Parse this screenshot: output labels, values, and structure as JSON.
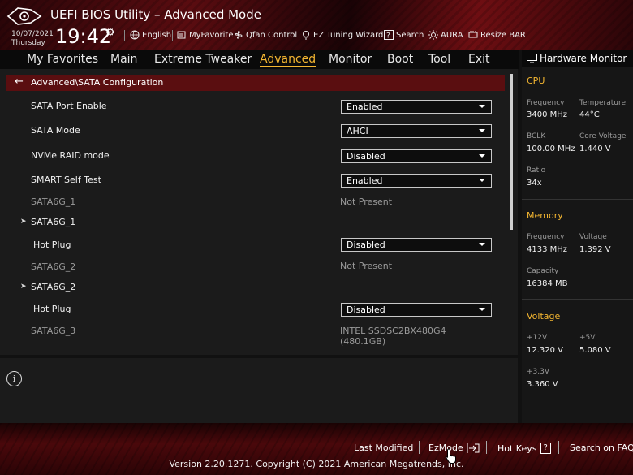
{
  "header": {
    "title": "UEFI BIOS Utility – Advanced Mode",
    "date": "10/07/2021",
    "day": "Thursday",
    "time": "19:42",
    "tools": [
      {
        "label": "English",
        "icon": "globe-icon"
      },
      {
        "label": "MyFavorite",
        "icon": "favorite-icon"
      },
      {
        "label": "Qfan Control",
        "icon": "fan-icon"
      },
      {
        "label": "EZ Tuning Wizard",
        "icon": "bulb-icon"
      },
      {
        "label": "Search",
        "icon": "search-icon"
      },
      {
        "label": "AURA",
        "icon": "aura-icon"
      },
      {
        "label": "Resize BAR",
        "icon": "resize-bar-icon"
      }
    ]
  },
  "menu": {
    "tabs": [
      "My Favorites",
      "Main",
      "Extreme Tweaker",
      "Advanced",
      "Monitor",
      "Boot",
      "Tool",
      "Exit"
    ],
    "active": "Advanced"
  },
  "breadcrumb": "Advanced\\SATA Configuration",
  "settings": [
    {
      "label": "SATA Port Enable",
      "value": "Enabled"
    },
    {
      "label": "SATA Mode",
      "value": "AHCI"
    },
    {
      "label": "NVMe RAID mode",
      "value": "Disabled"
    },
    {
      "label": "SMART Self Test",
      "value": "Enabled"
    },
    {
      "label": "SATA6G_1",
      "value": "Not Present"
    },
    {
      "label": "SATA6G_1"
    },
    {
      "label": "Hot Plug",
      "value": "Disabled"
    },
    {
      "label": "SATA6G_2",
      "value": "Not Present"
    },
    {
      "label": "SATA6G_2"
    },
    {
      "label": "Hot Plug",
      "value": "Disabled"
    },
    {
      "label": "SATA6G_3",
      "value": "INTEL SSDSC2BX480G4",
      "value2": "(480.1GB)"
    }
  ],
  "hardware_monitor": {
    "title": "Hardware Monitor",
    "cpu": {
      "heading": "CPU",
      "frequency_label": "Frequency",
      "frequency": "3400 MHz",
      "temperature_label": "Temperature",
      "temperature": "44°C",
      "bclk_label": "BCLK",
      "bclk": "100.00 MHz",
      "core_voltage_label": "Core Voltage",
      "core_voltage": "1.440 V",
      "ratio_label": "Ratio",
      "ratio": "34x"
    },
    "memory": {
      "heading": "Memory",
      "frequency_label": "Frequency",
      "frequency": "4133 MHz",
      "voltage_label": "Voltage",
      "voltage": "1.392 V",
      "capacity_label": "Capacity",
      "capacity": "16384 MB"
    },
    "voltage": {
      "heading": "Voltage",
      "v12_label": "+12V",
      "v12": "12.320 V",
      "v5_label": "+5V",
      "v5": "5.080 V",
      "v33_label": "+3.3V",
      "v33": "3.360 V"
    }
  },
  "footer": {
    "last_modified": "Last Modified",
    "ezmode": "EzMode",
    "hotkeys": "Hot Keys",
    "hotkeys_key": "?",
    "search_faq": "Search on FAQ",
    "version": "Version 2.20.1271. Copyright (C) 2021 American Megatrends, Inc."
  },
  "colors": {
    "accent": "#f5b731",
    "breadcrumb_bg": "#5a0e10",
    "panel_bg": "#1b1b1b"
  }
}
